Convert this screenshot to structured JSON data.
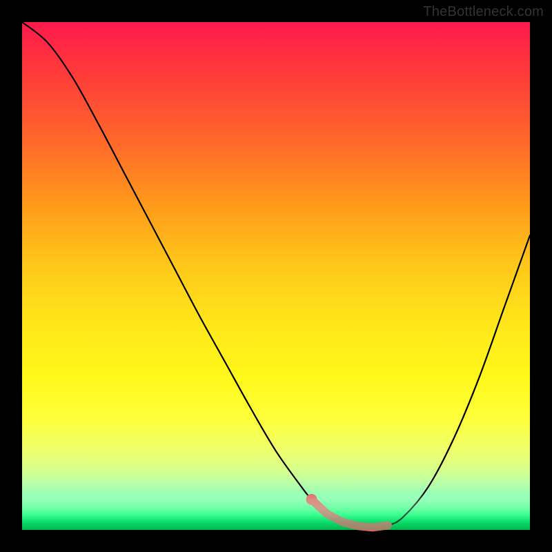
{
  "attribution": "TheBottleneck.com",
  "colors": {
    "curve_stroke": "#000000",
    "marker_stroke": "#d66a6a",
    "marker_fill": "#d66a6a",
    "frame_bg": "#000000"
  },
  "chart_data": {
    "type": "line",
    "title": "",
    "xlabel": "",
    "ylabel": "",
    "xlim": [
      0,
      100
    ],
    "ylim": [
      0,
      100
    ],
    "grid": false,
    "legend": false,
    "series": [
      {
        "name": "curve",
        "x": [
          0,
          5,
          10,
          15,
          20,
          25,
          30,
          35,
          40,
          45,
          50,
          55,
          57,
          60,
          63,
          66,
          69,
          72,
          75,
          80,
          85,
          90,
          95,
          100
        ],
        "y": [
          100,
          96,
          89,
          80,
          70.5,
          61,
          51.5,
          42,
          33,
          24,
          15.5,
          8.5,
          6,
          3.2,
          1.6,
          0.8,
          0.5,
          0.9,
          2.5,
          8.5,
          18,
          30,
          44,
          58
        ]
      }
    ],
    "markers": {
      "name": "highlight",
      "x": [
        57,
        60,
        63,
        66,
        69,
        72
      ],
      "y": [
        6,
        3.2,
        1.6,
        0.8,
        0.5,
        0.9
      ]
    }
  }
}
